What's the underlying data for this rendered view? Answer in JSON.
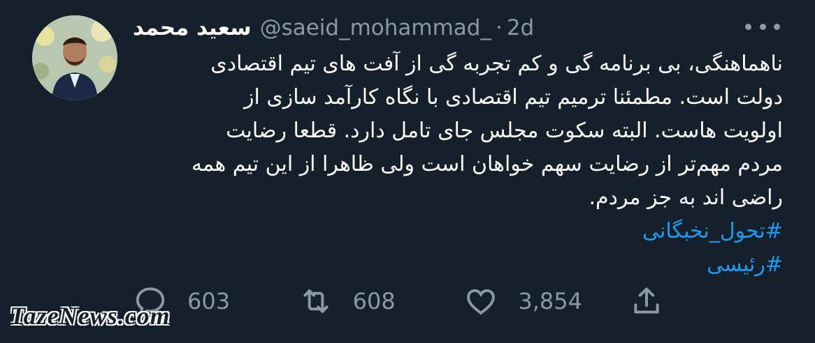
{
  "tweet": {
    "author_name": "سعید محمد",
    "handle": "@saeid_mohammad_",
    "separator": "·",
    "time": "2d",
    "text_lines": [
      "ناهماهنگی، بی برنامه گی و کم تجربه گی از آفت های تیم اقتصادی",
      "دولت است. مطمئنا ترمیم تیم اقتصادی با نگاه کارآمد سازی از",
      "اولویت هاست. البته سکوت مجلس جای تامل دارد. قطعا رضایت",
      "مردم مهم‌تر از رضایت سهم خواهان است ولی ظاهرا از این تیم همه",
      "راضی اند به جز مردم."
    ],
    "hashtags": [
      "#تحول_نخبگانی",
      "#رئیسی"
    ]
  },
  "actions": {
    "replies": "603",
    "retweets": "608",
    "likes": "3,854"
  },
  "icons": {
    "more": "more-horizontal-icon",
    "reply": "reply-bubble-icon",
    "retweet": "retweet-icon",
    "like": "heart-icon",
    "share": "share-upload-icon"
  },
  "watermark": "TazeNews.com",
  "colors": {
    "background": "#15202b",
    "text": "#ffffff",
    "muted": "#8b98a5",
    "link": "#1d9bf0"
  }
}
